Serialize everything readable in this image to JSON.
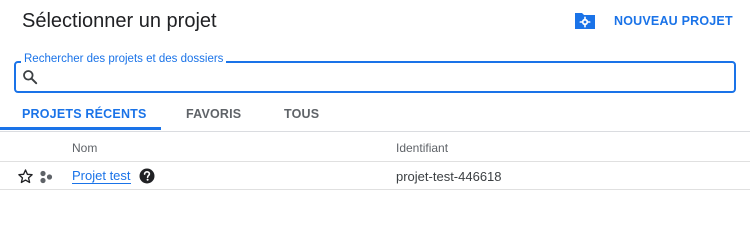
{
  "dialog": {
    "title": "Sélectionner un projet",
    "new_project_label": "NOUVEAU PROJET"
  },
  "search": {
    "label": "Rechercher des projets et des dossiers",
    "value": "",
    "placeholder": ""
  },
  "tabs": [
    {
      "label": "PROJETS RÉCENTS",
      "active": true
    },
    {
      "label": "FAVORIS",
      "active": false
    },
    {
      "label": "TOUS",
      "active": false
    }
  ],
  "table": {
    "columns": [
      "Nom",
      "Identifiant"
    ],
    "rows": [
      {
        "name": "Projet test",
        "id": "projet-test-446618",
        "starred": false
      }
    ]
  },
  "icons": {
    "folder_settings": "folder-gear-icon",
    "search": "search-icon",
    "star": "star-outline-icon",
    "project": "project-dots-icon",
    "help": "help-circle-icon"
  },
  "colors": {
    "accent": "#1a73e8",
    "text": "#202124",
    "muted": "#5f6368"
  }
}
